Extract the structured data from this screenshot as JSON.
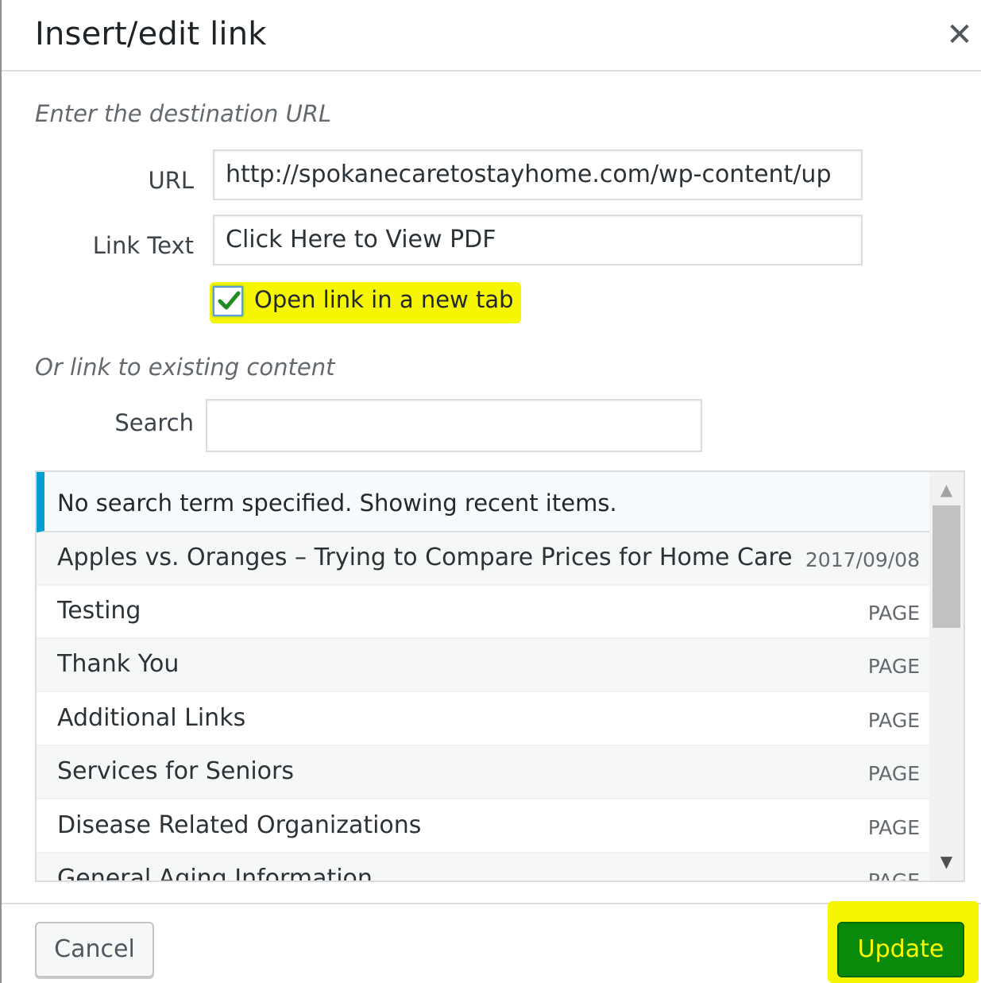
{
  "dialog": {
    "title": "Insert/edit link",
    "close_icon": "close-icon"
  },
  "destination": {
    "heading": "Enter the destination URL",
    "url_label": "URL",
    "url_value": "http://spokanecaretostayhome.com/wp-content/up",
    "link_text_label": "Link Text",
    "link_text_value": "Click Here to View PDF",
    "new_tab_label": "Open link in a new tab",
    "new_tab_checked": true
  },
  "existing": {
    "heading": "Or link to existing content",
    "search_label": "Search",
    "search_value": "",
    "notice": "No search term specified. Showing recent items.",
    "items": [
      {
        "title": "Apples vs. Oranges – Trying to Compare Prices for Home Care",
        "meta": "2017/09/08"
      },
      {
        "title": "Testing",
        "meta": "PAGE"
      },
      {
        "title": "Thank You",
        "meta": "PAGE"
      },
      {
        "title": "Additional Links",
        "meta": "PAGE"
      },
      {
        "title": "Services for Seniors",
        "meta": "PAGE"
      },
      {
        "title": "Disease Related Organizations",
        "meta": "PAGE"
      },
      {
        "title": "General Aging Information",
        "meta": "PAGE"
      }
    ]
  },
  "footer": {
    "cancel_label": "Cancel",
    "update_label": "Update"
  },
  "colors": {
    "highlight": "#f6f600",
    "update_button": "#0a8a0a",
    "notice_accent": "#00a0d2"
  }
}
